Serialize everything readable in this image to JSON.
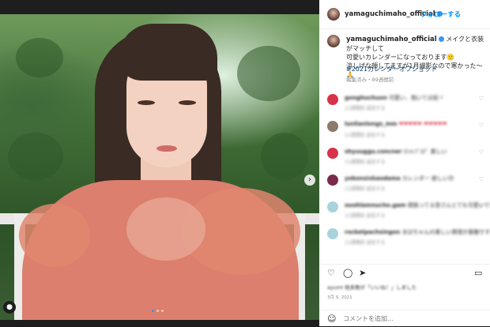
{
  "post": {
    "username": "yamaguchimaho_official",
    "follow_label": "フォローする",
    "caption_lines": [
      "メイクと衣装がマッチして",
      "可愛いカレンダーになっております🙂",
      "涼しげな顔してますが1月撮影なので寒かった〜🙏"
    ],
    "hashtag": "#2021カレンダーオフショット",
    "meta": "編集済み・89週間前",
    "next_icon": "›",
    "user_tag_icon": "person-icon"
  },
  "comments": [
    {
      "user": "gonghuchuon",
      "text": "可愛い、抱いてほ前ヾ",
      "sub": "11週間前  返信する",
      "avatar_color": "#d8324a"
    },
    {
      "user": "lunlianlongs_mm",
      "text": "❤❤❤❤❤  ❤❤❤❤❤",
      "sub": "11週間前  返信する",
      "avatar_color": "#8c7a6b"
    },
    {
      "user": "shyuuggu.concner",
      "text": "ｵｼｬﾚﾌﾟﾛｸﾞ  美しい",
      "sub": "11週間前  返信する",
      "avatar_color": "#d8324a"
    },
    {
      "user": "yokonsixkaodama",
      "text": "カレンダー 欲しい😊",
      "sub": "11週間前  返信する",
      "avatar_color": "#7a2a4a"
    },
    {
      "user": "ooohlamnucho.gam",
      "text": "頑張ってる皆さんとても可愛いですね",
      "sub": "11週間前  返信する",
      "avatar_color": "#a9d3dc"
    },
    {
      "user": "rocketpachsingon",
      "text": "まほちゃんの美しい表情が素敵です",
      "sub": "11週間前  返信する",
      "avatar_color": "#a9d3dc"
    }
  ],
  "actions": {
    "like_icon": "♡",
    "comment_icon": "◯",
    "share_icon": "➤",
    "save_icon": "▭"
  },
  "likes_text": "ayumi  他多数が「いいね！」しました",
  "date": "3月 9, 2021",
  "comment_input": {
    "emoji_icon": "☺",
    "placeholder": "コメントを追加..."
  }
}
